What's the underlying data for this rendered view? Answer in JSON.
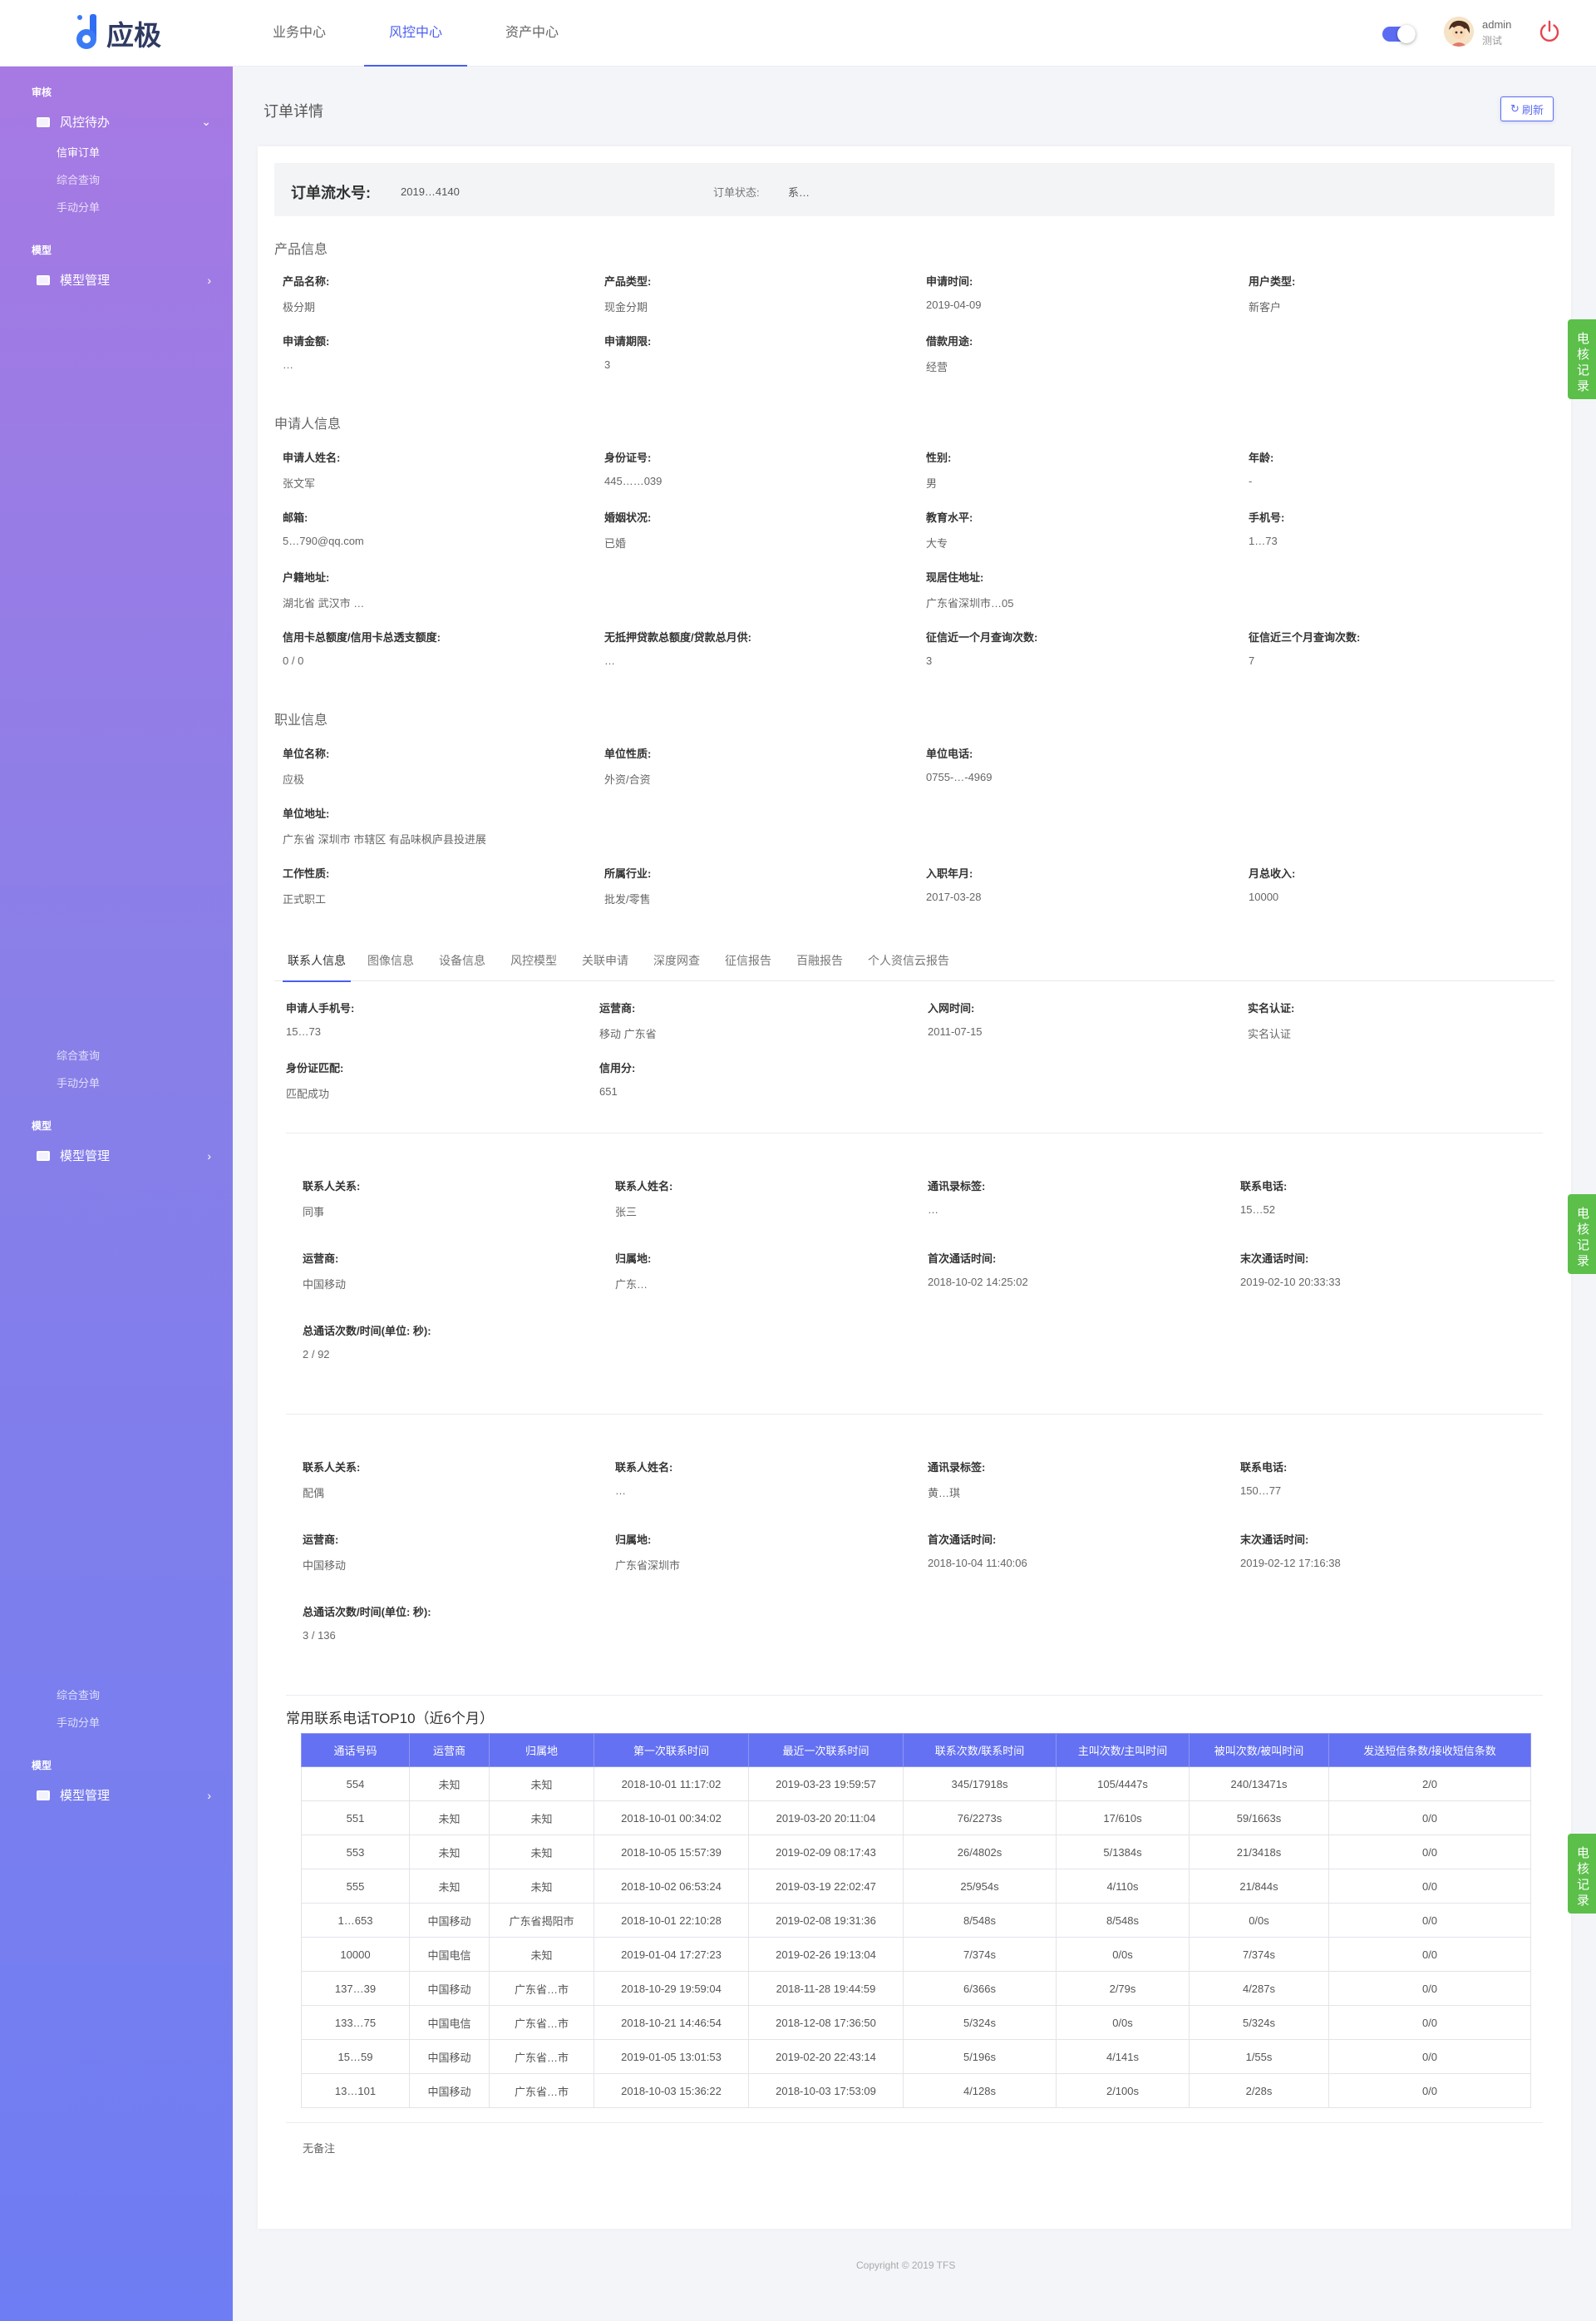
{
  "app": {
    "logo_text": "应极",
    "nav_tabs": [
      "业务中心",
      "风控中心",
      "资产中心"
    ],
    "user_name": "admin",
    "user_role": "测试"
  },
  "sidebar": {
    "group_review": "审核",
    "risk_pending": "风控待办",
    "sub_items": [
      "信审订单",
      "综合查询",
      "手动分单"
    ],
    "group_model": "模型",
    "model_mgmt": "模型管理"
  },
  "page": {
    "title": "订单详情",
    "refresh": "刷新"
  },
  "order": {
    "label": "订单流水号:",
    "number": "2019…4140",
    "status_label": "订单状态:",
    "status_value": "系…"
  },
  "product": {
    "section": "产品信息",
    "fields": [
      {
        "label": "产品名称:",
        "value": "极分期"
      },
      {
        "label": "产品类型:",
        "value": "现金分期"
      },
      {
        "label": "申请时间:",
        "value": "2019-04-09"
      },
      {
        "label": "用户类型:",
        "value": "新客户"
      },
      {
        "label": "申请金额:",
        "value": "…"
      },
      {
        "label": "申请期限:",
        "value": "3"
      },
      {
        "label": "借款用途:",
        "value": "经营"
      }
    ]
  },
  "applicant": {
    "section": "申请人信息",
    "fields": [
      {
        "label": "申请人姓名:",
        "value": "张文军"
      },
      {
        "label": "身份证号:",
        "value": "445……039"
      },
      {
        "label": "性别:",
        "value": "男"
      },
      {
        "label": "年龄:",
        "value": "-"
      },
      {
        "label": "邮箱:",
        "value": "5…790@qq.com"
      },
      {
        "label": "婚姻状况:",
        "value": "已婚"
      },
      {
        "label": "教育水平:",
        "value": "大专"
      },
      {
        "label": "手机号:",
        "value": "1…73"
      },
      {
        "label": "户籍地址:",
        "value": "湖北省 武汉市 …"
      },
      {
        "label": "现居住地址:",
        "value": "广东省深圳市…05"
      },
      {
        "label": "信用卡总额度/信用卡总透支额度:",
        "value": "0 / 0"
      },
      {
        "label": "无抵押贷款总额度/贷款总月供:",
        "value": "…"
      },
      {
        "label": "征信近一个月查询次数:",
        "value": "3"
      },
      {
        "label": "征信近三个月查询次数:",
        "value": "7"
      }
    ]
  },
  "job": {
    "section": "职业信息",
    "fields": [
      {
        "label": "单位名称:",
        "value": "应极"
      },
      {
        "label": "单位性质:",
        "value": "外资/合资"
      },
      {
        "label": "单位电话:",
        "value": "0755-…-4969"
      },
      {
        "label": "单位地址:",
        "value": "广东省 深圳市 市辖区 有品味枫庐县投进展"
      },
      {
        "label": "工作性质:",
        "value": "正式职工"
      },
      {
        "label": "所属行业:",
        "value": "批发/零售"
      },
      {
        "label": "入职年月:",
        "value": "2017-03-28"
      },
      {
        "label": "月总收入:",
        "value": "10000"
      }
    ]
  },
  "detail_tabs": [
    "联系人信息",
    "图像信息",
    "设备信息",
    "风控模型",
    "关联申请",
    "深度网查",
    "征信报告",
    "百融报告",
    "个人资信云报告"
  ],
  "contact_info": {
    "fields": [
      {
        "label": "申请人手机号:",
        "value": "15…73"
      },
      {
        "label": "运营商:",
        "value": "移动 广东省"
      },
      {
        "label": "入网时间:",
        "value": "2011-07-15"
      },
      {
        "label": "实名认证:",
        "value": "实名认证"
      },
      {
        "label": "身份证匹配:",
        "value": "匹配成功"
      },
      {
        "label": "信用分:",
        "value": "651"
      }
    ]
  },
  "contacts": [
    {
      "fields": [
        {
          "label": "联系人关系:",
          "value": "同事"
        },
        {
          "label": "联系人姓名:",
          "value": "张三"
        },
        {
          "label": "通讯录标签:",
          "value": "…"
        },
        {
          "label": "联系电话:",
          "value": "15…52"
        },
        {
          "label": "运营商:",
          "value": "中国移动"
        },
        {
          "label": "归属地:",
          "value": "广东…"
        },
        {
          "label": "首次通话时间:",
          "value": "2018-10-02 14:25:02"
        },
        {
          "label": "末次通话时间:",
          "value": "2019-02-10 20:33:33"
        },
        {
          "label": "总通话次数/时间(单位: 秒):",
          "value": "2 / 92"
        }
      ]
    },
    {
      "fields": [
        {
          "label": "联系人关系:",
          "value": "配偶"
        },
        {
          "label": "联系人姓名:",
          "value": "…"
        },
        {
          "label": "通讯录标签:",
          "value": "黄…琪"
        },
        {
          "label": "联系电话:",
          "value": "150…77"
        },
        {
          "label": "运营商:",
          "value": "中国移动"
        },
        {
          "label": "归属地:",
          "value": "广东省深圳市"
        },
        {
          "label": "首次通话时间:",
          "value": "2018-10-04 11:40:06"
        },
        {
          "label": "末次通话时间:",
          "value": "2019-02-12 17:16:38"
        },
        {
          "label": "总通话次数/时间(单位: 秒):",
          "value": "3 / 136"
        }
      ]
    }
  ],
  "top10": {
    "title": "常用联系电话TOP10（近6个月）",
    "headers": [
      "通话号码",
      "运营商",
      "归属地",
      "第一次联系时间",
      "最近一次联系时间",
      "联系次数/联系时间",
      "主叫次数/主叫时间",
      "被叫次数/被叫时间",
      "发送短信条数/接收短信条数"
    ],
    "rows": [
      [
        "554",
        "未知",
        "未知",
        "2018-10-01 11:17:02",
        "2019-03-23 19:59:57",
        "345/17918s",
        "105/4447s",
        "240/13471s",
        "2/0"
      ],
      [
        "551",
        "未知",
        "未知",
        "2018-10-01 00:34:02",
        "2019-03-20 20:11:04",
        "76/2273s",
        "17/610s",
        "59/1663s",
        "0/0"
      ],
      [
        "553",
        "未知",
        "未知",
        "2018-10-05 15:57:39",
        "2019-02-09 08:17:43",
        "26/4802s",
        "5/1384s",
        "21/3418s",
        "0/0"
      ],
      [
        "555",
        "未知",
        "未知",
        "2018-10-02 06:53:24",
        "2019-03-19 22:02:47",
        "25/954s",
        "4/110s",
        "21/844s",
        "0/0"
      ],
      [
        "1…653",
        "中国移动",
        "广东省揭阳市",
        "2018-10-01 22:10:28",
        "2019-02-08 19:31:36",
        "8/548s",
        "8/548s",
        "0/0s",
        "0/0"
      ],
      [
        "10000",
        "中国电信",
        "未知",
        "2019-01-04 17:27:23",
        "2019-02-26 19:13:04",
        "7/374s",
        "0/0s",
        "7/374s",
        "0/0"
      ],
      [
        "137…39",
        "中国移动",
        "广东省…市",
        "2018-10-29 19:59:04",
        "2018-11-28 19:44:59",
        "6/366s",
        "2/79s",
        "4/287s",
        "0/0"
      ],
      [
        "133…75",
        "中国电信",
        "广东省…市",
        "2018-10-21 14:46:54",
        "2018-12-08 17:36:50",
        "5/324s",
        "0/0s",
        "5/324s",
        "0/0"
      ],
      [
        "15…59",
        "中国移动",
        "广东省…市",
        "2019-01-05 13:01:53",
        "2019-02-20 22:43:14",
        "5/196s",
        "4/141s",
        "1/55s",
        "0/0"
      ],
      [
        "13…101",
        "中国移动",
        "广东省…市",
        "2018-10-03 15:36:22",
        "2018-10-03 17:53:09",
        "4/128s",
        "2/100s",
        "2/28s",
        "0/0"
      ]
    ]
  },
  "note": "无备注",
  "footer": "Copyright © 2019 TFS",
  "float_tab": "电核记录",
  "colors": {
    "accent": "#4a5ef0",
    "table_header": "#6471f2",
    "float_tab": "#5bbf4a"
  }
}
